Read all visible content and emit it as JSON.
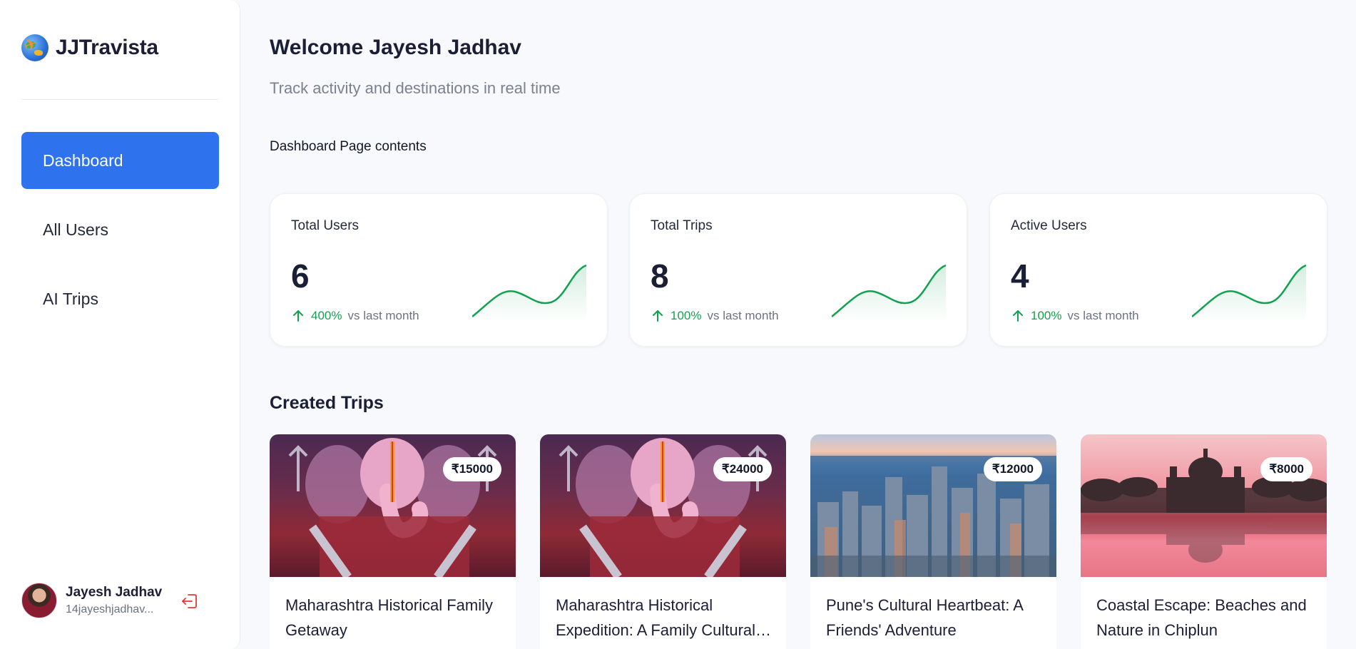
{
  "brand": {
    "name": "JJTravista",
    "logo_icon": "globe-plane-icon"
  },
  "sidebar": {
    "items": [
      {
        "label": "Dashboard",
        "active": true
      },
      {
        "label": "All Users",
        "active": false
      },
      {
        "label": "AI Trips",
        "active": false
      }
    ],
    "user": {
      "name": "Jayesh Jadhav",
      "email": "14jayeshjadhav..."
    }
  },
  "header": {
    "title": "Welcome Jayesh Jadhav",
    "subtitle": "Track activity and destinations in real time",
    "page_contents": "Dashboard Page contents"
  },
  "stats": [
    {
      "title": "Total Users",
      "value": "6",
      "change": "400%",
      "vs": "vs last month"
    },
    {
      "title": "Total Trips",
      "value": "8",
      "change": "100%",
      "vs": "vs last month"
    },
    {
      "title": "Active Users",
      "value": "4",
      "change": "100%",
      "vs": "vs last month"
    }
  ],
  "created_trips": {
    "title": "Created Trips",
    "trips": [
      {
        "title": "Maharashtra Historical Family Getaway",
        "price": "₹15000"
      },
      {
        "title": "Maharashtra Historical Expedition: A Family Cultural Journey",
        "price": "₹24000"
      },
      {
        "title": "Pune's Cultural Heartbeat: A Friends' Adventure",
        "price": "₹12000"
      },
      {
        "title": "Coastal Escape: Beaches and Nature in Chiplun",
        "price": "₹8000"
      }
    ]
  },
  "colors": {
    "accent": "#2f72ee",
    "positive": "#12a150",
    "logout": "#e53935"
  }
}
